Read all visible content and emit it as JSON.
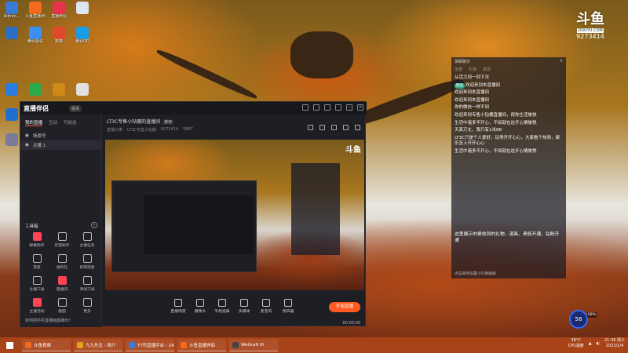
{
  "desktop": {
    "icons": [
      {
        "label": "Admin...",
        "color": "#3a7bd5"
      },
      {
        "label": "斗鱼直播伴侣",
        "color": "#f26b1d"
      },
      {
        "label": "直播伴侣",
        "color": "#e8334a"
      },
      {
        "label": "",
        "color": "#dde6f0"
      },
      {
        "label": "",
        "color": "#2f6ec8"
      },
      {
        "label": "腾讯会议",
        "color": "#3b8ff0"
      },
      {
        "label": "数数",
        "color": "#e04a2a"
      },
      {
        "label": "腾讯QQ",
        "color": "#1a9de6"
      },
      {
        "label": "",
        "color": "#2b7be0"
      },
      {
        "label": "",
        "color": "#2aaa4a"
      },
      {
        "label": "",
        "color": "#d08a1a"
      },
      {
        "label": "",
        "color": "#e0e0e0"
      },
      {
        "label": "",
        "color": "#1f6fd0"
      },
      {
        "label": "",
        "color": "#2f9a3a"
      },
      {
        "label": "",
        "color": "#c0c0c0"
      },
      {
        "label": "",
        "color": "#5a9a2a"
      },
      {
        "label": "",
        "color": "#7a7a9a"
      }
    ],
    "watermark": {
      "mark": "斗鱼",
      "site": "DOUYU.COM",
      "room_id": "9273414"
    }
  },
  "app": {
    "brand": "直播伴侣",
    "version": "版本",
    "left_tabs": [
      "我的直播",
      "互动",
      "可放送"
    ],
    "scenes": [
      "场景号",
      "主播 1"
    ],
    "tools_title": "工具箱",
    "tools": [
      {
        "label": "弹幕助手",
        "red": true
      },
      {
        "label": "房管助手",
        "red": false
      },
      {
        "label": "主播任务",
        "red": false
      },
      {
        "label": "连麦",
        "red": false
      },
      {
        "label": "福利社",
        "red": false
      },
      {
        "label": "视频连麦",
        "red": false
      },
      {
        "label": "主播工具",
        "red": false
      },
      {
        "label": "直播间",
        "red": true
      },
      {
        "label": "添加工具",
        "red": false
      },
      {
        "label": "主播活动",
        "red": true
      },
      {
        "label": "截图",
        "red": false
      },
      {
        "label": "更多",
        "red": false
      }
    ],
    "bottom_tip": "如何把手机直播画面播出？",
    "room_title": "LT3C专售小钻棚的直播间",
    "room_tag": "推荐",
    "room_meta": [
      "直播分类",
      "LT3C专售小钻棚",
      "9273414",
      "5887"
    ],
    "bottom_bar": [
      "直播场景",
      "摄像头",
      "手机投屏",
      "多媒体",
      "麦克风",
      "扬声器"
    ],
    "start_label": "开始直播",
    "status_text": "00:00:00"
  },
  "chat": {
    "header": "弹幕聊天",
    "tabs": [
      "全部",
      "礼物",
      "贵宾"
    ],
    "messages": [
      {
        "badge": "",
        "name": "",
        "text": "从活力到一到下次"
      },
      {
        "badge": "粉丝",
        "name": "",
        "text": "欢迎来到本直播间"
      },
      {
        "badge": "",
        "name": "",
        "text": "欢迎来到本直播间"
      },
      {
        "badge": "",
        "name": "",
        "text": "欢迎来到本直播间"
      },
      {
        "badge": "",
        "name": "",
        "text": ""
      },
      {
        "badge": "",
        "name": "",
        "text": "你的微信一样不到"
      },
      {
        "badge": "",
        "name": "",
        "text": "欢迎来到专售小钻棚直播间，祝你生活愉快"
      },
      {
        "badge": "",
        "name": "",
        "text": "生活中诸多不开心，不如就在这开心情愉悦"
      },
      {
        "badge": "",
        "name": "",
        "text": "天真万丈，我只有1米88"
      },
      {
        "badge": "",
        "name": "",
        "text": "LT3C只是个人爱好，玩得开开心心，大家看个热闹，娱乐至上开开心心"
      },
      {
        "badge": "",
        "name": "",
        "text": "生活中诸多不开心，不如就在这开心情愉悦"
      }
    ],
    "note": "这里展示的是收到的礼物、道具、贵族开通、钻粉开通",
    "foot": "点击单项设置小礼物屏蔽"
  },
  "widget": {
    "circle_text": "58",
    "pct": "68%"
  },
  "taskbar": {
    "apps": [
      {
        "label": "斗鱼视频",
        "color": "#f26b1d"
      },
      {
        "label": "九九先生 - 简介",
        "color": "#e8a21d"
      },
      {
        "label": "TT讯直播平台 - 24.0",
        "color": "#3a7bd5"
      },
      {
        "label": "斗鱼直播伴侣",
        "color": "#f26b1d"
      },
      {
        "label": "WeGraft III",
        "color": "#444"
      }
    ],
    "cpu_label": "CPU温度",
    "cpu_value": "39°C",
    "time": "21:36 周三",
    "date": "2023/1/4"
  }
}
